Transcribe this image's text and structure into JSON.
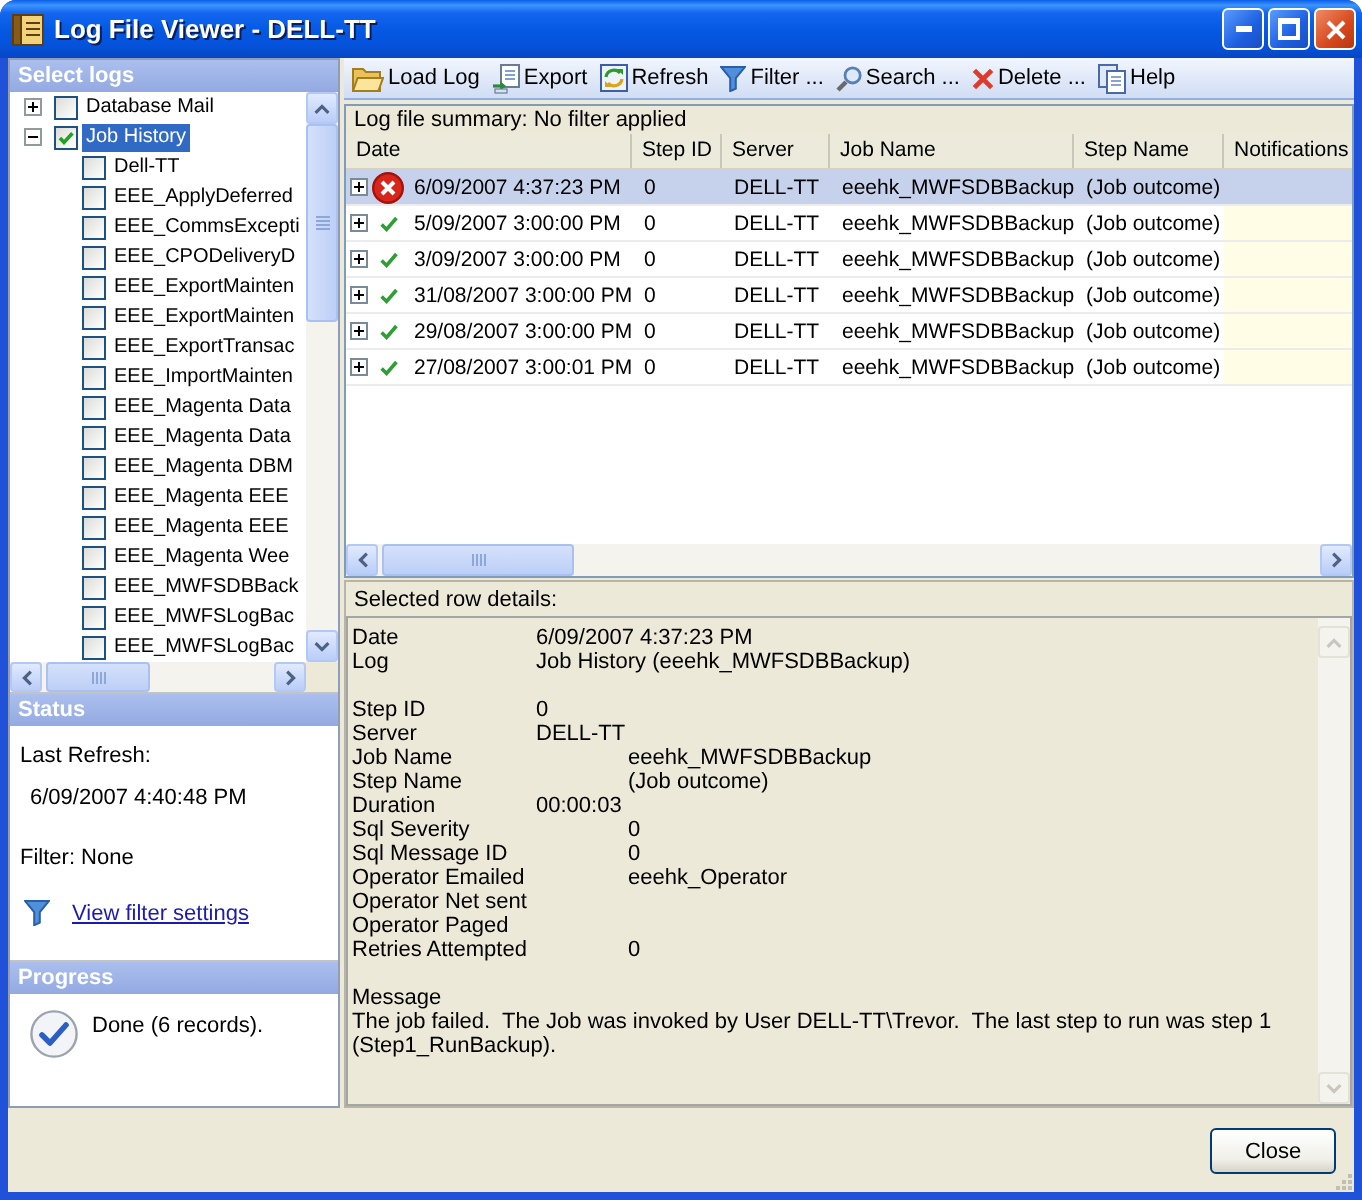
{
  "window": {
    "title": "Log File Viewer - DELL-TT"
  },
  "select_logs": {
    "title": "Select logs",
    "tree": [
      {
        "label": "Database Mail",
        "expanded": false,
        "checked": false,
        "selected": false
      },
      {
        "label": "Job History",
        "expanded": true,
        "checked": true,
        "selected": true,
        "children": [
          {
            "label": "Dell-TT",
            "checked": false,
            "selected": false
          },
          {
            "label": "EEE_ApplyDeferred",
            "checked": false,
            "selected": false
          },
          {
            "label": "EEE_CommsExcepti",
            "checked": false,
            "selected": false
          },
          {
            "label": "EEE_CPODeliveryD",
            "checked": false,
            "selected": false
          },
          {
            "label": "EEE_ExportMainten",
            "checked": false,
            "selected": false
          },
          {
            "label": "EEE_ExportMainten",
            "checked": false,
            "selected": false
          },
          {
            "label": "EEE_ExportTransac",
            "checked": false,
            "selected": false
          },
          {
            "label": "EEE_ImportMainten",
            "checked": false,
            "selected": false
          },
          {
            "label": "EEE_Magenta Data",
            "checked": false,
            "selected": false
          },
          {
            "label": "EEE_Magenta Data",
            "checked": false,
            "selected": false
          },
          {
            "label": "EEE_Magenta DBM",
            "checked": false,
            "selected": false
          },
          {
            "label": "EEE_Magenta EEE",
            "checked": false,
            "selected": false
          },
          {
            "label": "EEE_Magenta EEE",
            "checked": false,
            "selected": false
          },
          {
            "label": "EEE_Magenta Wee",
            "checked": false,
            "selected": false
          },
          {
            "label": "EEE_MWFSDBBack",
            "checked": false,
            "selected": false
          },
          {
            "label": "EEE_MWFSLogBac",
            "checked": false,
            "selected": false
          },
          {
            "label": "EEE_MWFSLogBac",
            "checked": false,
            "selected": false
          }
        ]
      }
    ]
  },
  "status": {
    "title": "Status",
    "last_refresh_label": "Last Refresh:",
    "last_refresh": "6/09/2007 4:40:48 PM",
    "filter": "Filter: None",
    "filter_link": "View filter settings"
  },
  "progress": {
    "title": "Progress",
    "message": "Done (6 records)."
  },
  "toolbar": [
    {
      "kind": "load",
      "label": "Load Log"
    },
    {
      "kind": "export",
      "label": "Export"
    },
    {
      "kind": "refresh",
      "label": "Refresh"
    },
    {
      "kind": "filter",
      "label": "Filter ..."
    },
    {
      "kind": "search",
      "label": "Search ..."
    },
    {
      "kind": "delete",
      "label": "Delete ..."
    },
    {
      "kind": "help",
      "label": "Help"
    }
  ],
  "table": {
    "summary": "Log file summary: No filter applied",
    "columns": [
      "Date",
      "Step ID",
      "Server",
      "Job Name",
      "Step Name",
      "Notifications"
    ],
    "rows": [
      {
        "selected": true,
        "expanded": false,
        "failed": true,
        "date": "6/09/2007 4:37:23 PM",
        "step_id": "0",
        "server": "DELL-TT",
        "job_name": "eeehk_MWFSDBBackup",
        "step_name": "(Job outcome)"
      },
      {
        "selected": false,
        "expanded": false,
        "failed": false,
        "date": "5/09/2007 3:00:00 PM",
        "step_id": "0",
        "server": "DELL-TT",
        "job_name": "eeehk_MWFSDBBackup",
        "step_name": "(Job outcome)"
      },
      {
        "selected": false,
        "expanded": false,
        "failed": false,
        "date": "3/09/2007 3:00:00 PM",
        "step_id": "0",
        "server": "DELL-TT",
        "job_name": "eeehk_MWFSDBBackup",
        "step_name": "(Job outcome)"
      },
      {
        "selected": false,
        "expanded": false,
        "failed": false,
        "date": "31/08/2007 3:00:00 PM",
        "step_id": "0",
        "server": "DELL-TT",
        "job_name": "eeehk_MWFSDBBackup",
        "step_name": "(Job outcome)"
      },
      {
        "selected": false,
        "expanded": false,
        "failed": false,
        "date": "29/08/2007 3:00:00 PM",
        "step_id": "0",
        "server": "DELL-TT",
        "job_name": "eeehk_MWFSDBBackup",
        "step_name": "(Job outcome)"
      },
      {
        "selected": false,
        "expanded": false,
        "failed": false,
        "date": "27/08/2007 3:00:01 PM",
        "step_id": "0",
        "server": "DELL-TT",
        "job_name": "eeehk_MWFSDBBackup",
        "step_name": "(Job outcome)"
      }
    ]
  },
  "details": {
    "title": "Selected row details:",
    "groups": [
      {
        "fields": [
          {
            "label": "Date",
            "value": "6/09/2007 4:37:23 PM"
          },
          {
            "label": "Log",
            "value": "Job History (eeehk_MWFSDBBackup)"
          }
        ]
      },
      {
        "fields": [
          {
            "label": "Step ID",
            "value": "0"
          },
          {
            "label": "Server",
            "value": "DELL-TT"
          },
          {
            "label": "Job Name",
            "value": "eeehk_MWFSDBBackup"
          },
          {
            "label": "Step Name",
            "value": "(Job outcome)"
          },
          {
            "label": "Duration",
            "value": "00:00:03"
          },
          {
            "label": "Sql Severity",
            "value": "0"
          },
          {
            "label": "Sql Message ID",
            "value": "0"
          },
          {
            "label": "Operator Emailed",
            "value": "eeehk_Operator"
          },
          {
            "label": "Operator Net sent"
          },
          {
            "label": "Operator Paged"
          },
          {
            "label": "Retries Attempted",
            "value": "0"
          }
        ]
      }
    ],
    "message_label": "Message",
    "message": "The job failed.  The Job was invoked by User DELL-TT\\Trevor.  The last step to run was step 1 (Step1_RunBackup)."
  },
  "buttons": [
    {
      "label": "Close"
    }
  ]
}
